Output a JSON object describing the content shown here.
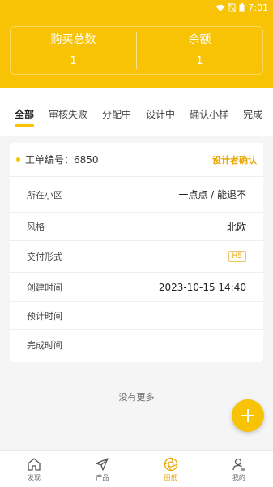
{
  "status_bar": {
    "time": "7:01"
  },
  "summary": {
    "purchase_label": "购买总数",
    "purchase_value": "1",
    "balance_label": "余额",
    "balance_value": "1"
  },
  "tabs": [
    {
      "label": "全部",
      "active": true
    },
    {
      "label": "审核失败"
    },
    {
      "label": "分配中"
    },
    {
      "label": "设计中"
    },
    {
      "label": "确认小样"
    },
    {
      "label": "完成"
    }
  ],
  "order": {
    "number_label": "工单编号：6850",
    "status": "设计者确认",
    "rows": [
      {
        "label": "所在小区",
        "value": "一点点 / 能退不"
      },
      {
        "label": "风格",
        "value": "北欧"
      },
      {
        "label": "交付形式",
        "value": "H5"
      },
      {
        "label": "创建时间",
        "value": "2023-10-15 14:40"
      },
      {
        "label": "预计时间",
        "value": ""
      },
      {
        "label": "完成时间",
        "value": ""
      }
    ]
  },
  "list": {
    "no_more": "没有更多"
  },
  "bottom_nav": [
    {
      "label": "发现",
      "icon": "home-icon"
    },
    {
      "label": "产品",
      "icon": "send-icon"
    },
    {
      "label": "图纸",
      "icon": "aperture-icon",
      "active": true
    },
    {
      "label": "我的",
      "icon": "user-icon"
    }
  ],
  "colors": {
    "accent": "#f7c304",
    "accent_text": "#e9a600"
  }
}
